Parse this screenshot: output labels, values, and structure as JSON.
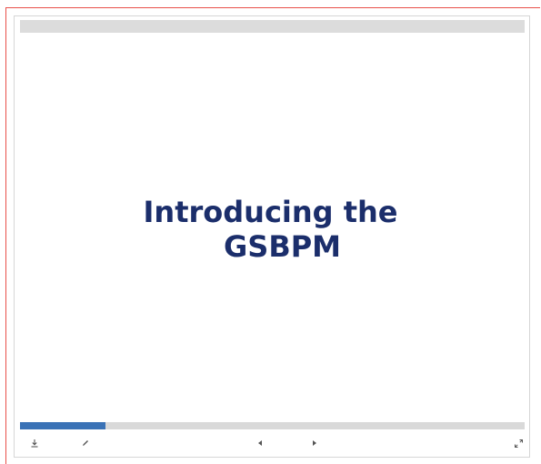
{
  "slide": {
    "title_line1": "Introducing the",
    "title_line2": "GSBPM",
    "title_color": "#1b2e6b"
  },
  "progress": {
    "fraction": 0.17,
    "color": "#3a72b6"
  },
  "toolbar": {
    "icons": [
      "download-icon",
      "pencil-icon",
      "previous-icon",
      "next-icon",
      "fullscreen-icon"
    ]
  }
}
